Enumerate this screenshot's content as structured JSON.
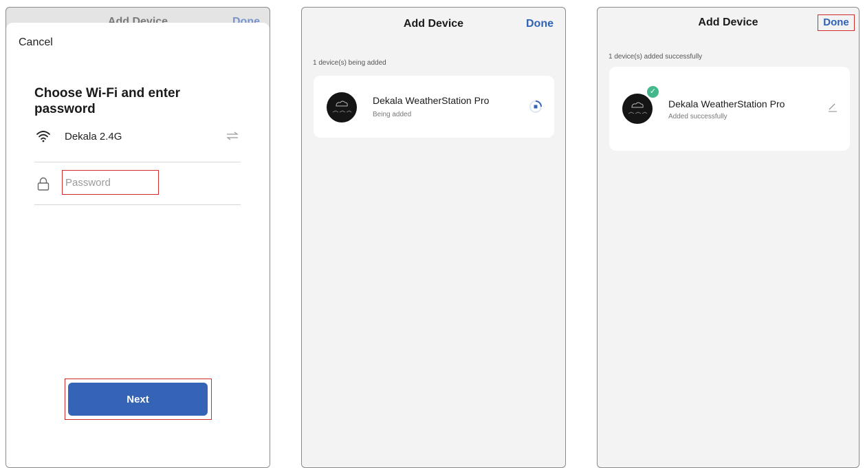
{
  "screen1": {
    "behind_title": "Add Device",
    "behind_done": "Done",
    "cancel": "Cancel",
    "title": "Choose Wi-Fi and enter password",
    "wifi_name": "Dekala 2.4G",
    "password_placeholder": "Password",
    "next_label": "Next"
  },
  "screen2": {
    "title": "Add Device",
    "done": "Done",
    "status": "1 device(s) being added",
    "device_name": "Dekala WeatherStation Pro",
    "device_status": "Being added"
  },
  "screen3": {
    "title": "Add Device",
    "done": "Done",
    "status": "1 device(s) added successfully",
    "device_name": "Dekala WeatherStation Pro",
    "device_status": "Added successfully"
  },
  "colors": {
    "accent": "#3563b5",
    "highlight": "#d02a2a",
    "success": "#44b88a"
  },
  "icons": [
    "wifi-icon",
    "swap-icon",
    "lock-icon",
    "spinner-icon",
    "check-icon",
    "edit-icon"
  ]
}
